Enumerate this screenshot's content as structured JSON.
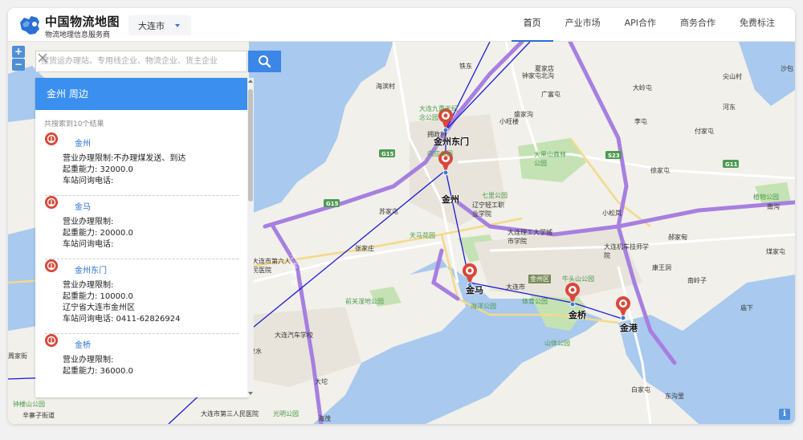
{
  "header": {
    "logo_title": "中国物流地图",
    "logo_subtitle": "物流地理信息服务商",
    "city": "大连市"
  },
  "nav": [
    {
      "label": "首页"
    },
    {
      "label": "产业市场"
    },
    {
      "label": "API合作"
    },
    {
      "label": "商务合作"
    },
    {
      "label": "免费标注"
    }
  ],
  "search": {
    "placeholder": "搜货运办理站、专用线企业、物流企业、货主企业",
    "value": ""
  },
  "zoom": {
    "in": "+",
    "out": "−"
  },
  "info_label": "i",
  "results": {
    "title": "金州 周边",
    "count_text": "共搜索到10个结果",
    "items": [
      {
        "name": "金州",
        "scope": "营业办理限制:不办理煤发送、到达",
        "capacity": "起重能力: 32000.0",
        "address": "",
        "phone": "车站问询电话:"
      },
      {
        "name": "金马",
        "scope": "营业办理限制:",
        "capacity": "起重能力: 20000.0",
        "address": "",
        "phone": "车站问询电话:"
      },
      {
        "name": "金州东门",
        "scope": "营业办理限制:",
        "capacity": "起重能力: 10000.0",
        "address": "辽宁省大连市金州区",
        "phone": "车站问询电话: 0411-62826924"
      },
      {
        "name": "金桥",
        "scope": "营业办理限制:",
        "capacity": "起重能力: 36000.0",
        "address": "",
        "phone": ""
      }
    ]
  },
  "stations": [
    {
      "name": "金州东门"
    },
    {
      "name": "金州"
    },
    {
      "name": "金马"
    },
    {
      "name": "金桥"
    },
    {
      "name": "金港"
    }
  ],
  "map_labels": [
    "海滨村",
    "铁东",
    "夏家店",
    "钟家屯北沟",
    "广富屯",
    "大岭屯",
    "尖山村",
    "沙包",
    "大连九重天纪念公园",
    "拥政村",
    "盛家沟",
    "小旺楼",
    "李屯",
    "付家屯",
    "河东",
    "大黑山森林公园",
    "苏家屯",
    "七里公园",
    "徐家屯",
    "小松岚",
    "植物公园",
    "南沟",
    "大沈海线",
    "大连市第六人民医院",
    "张家庄",
    "天马花园",
    "大连理工大学城市学院",
    "大连机车技师学院",
    "郝家甸",
    "康王洞",
    "牛头山公园",
    "金州区",
    "南岭子",
    "煤家屯",
    "前关湿地公园",
    "海洋公园",
    "体育公园",
    "山体公园",
    "大连汽车学校",
    "周家街",
    "泉水",
    "钟楼山公园",
    "辛寨子街道",
    "光明公园",
    "海茂",
    "庙下",
    "白家屯",
    "东沟里",
    "大连市第三人民医院",
    "辽宁轻工职业学院",
    "向应公园",
    "大坨",
    "大连市"
  ],
  "roads": [
    "G15",
    "S23",
    "G11",
    "G15"
  ],
  "colors": {
    "accent": "#3b86e6",
    "panel_header": "#3b8fee",
    "link": "#2b6fd4",
    "station_icon": "#d9483a",
    "route_line": "#1a1ad8",
    "expressway": "#a77fe0",
    "water": "#a9c9ee",
    "park": "#c4e2b3"
  }
}
